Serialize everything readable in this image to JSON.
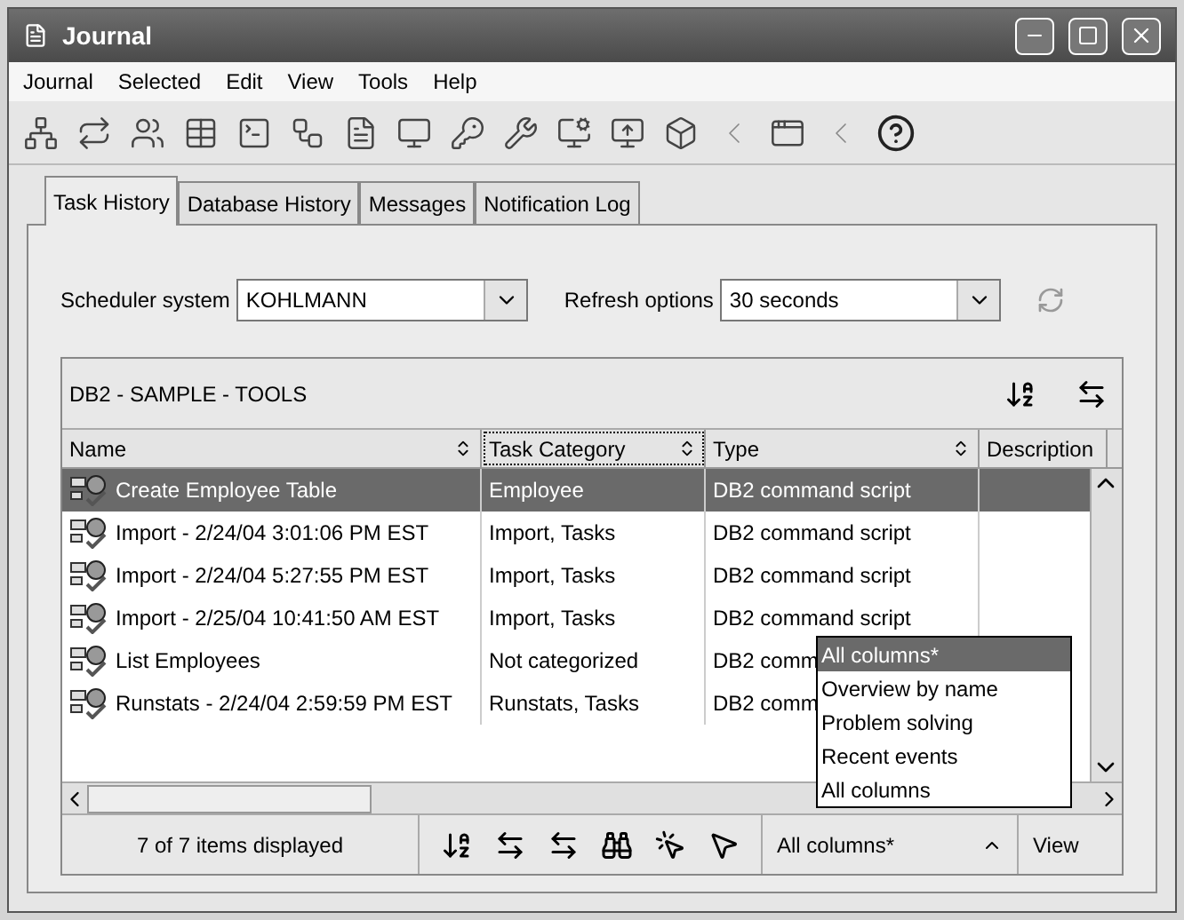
{
  "window": {
    "title": "Journal"
  },
  "menu": [
    "Journal",
    "Selected",
    "Edit",
    "View",
    "Tools",
    "Help"
  ],
  "tabs": [
    {
      "label": "Task History",
      "selected": true
    },
    {
      "label": "Database History",
      "selected": false
    },
    {
      "label": "Messages",
      "selected": false
    },
    {
      "label": "Notification Log",
      "selected": false
    }
  ],
  "scheduler": {
    "label": "Scheduler system",
    "value": "KOHLMANN"
  },
  "refresh": {
    "label": "Refresh options",
    "value": "30 seconds"
  },
  "table": {
    "title": "DB2 - SAMPLE - TOOLS",
    "columns": [
      {
        "label": "Name",
        "focused": false
      },
      {
        "label": "Task Category",
        "focused": true
      },
      {
        "label": "Type",
        "focused": false
      },
      {
        "label": "Description",
        "focused": false
      }
    ],
    "rows": [
      {
        "name": "Create Employee Table",
        "category": "Employee",
        "type": "DB2 command script",
        "selected": true
      },
      {
        "name": "Import - 2/24/04 3:01:06 PM EST",
        "category": "Import, Tasks",
        "type": "DB2 command script",
        "selected": false
      },
      {
        "name": "Import - 2/24/04 5:27:55 PM EST",
        "category": "Import, Tasks",
        "type": "DB2 command script",
        "selected": false
      },
      {
        "name": "Import - 2/25/04 10:41:50 AM EST",
        "category": "Import, Tasks",
        "type": "DB2 command script",
        "selected": false
      },
      {
        "name": "List Employees",
        "category": "Not categorized",
        "type": "DB2 comm",
        "selected": false
      },
      {
        "name": "Runstats - 2/24/04 2:59:59 PM EST",
        "category": "Runstats, Tasks",
        "type": "DB2 comm",
        "selected": false
      }
    ]
  },
  "status": "7 of 7 items displayed",
  "view_select": {
    "value": "All columns*",
    "options": [
      {
        "label": "All columns*",
        "selected": true
      },
      {
        "label": "Overview by name",
        "selected": false
      },
      {
        "label": "Problem solving",
        "selected": false
      },
      {
        "label": "Recent events",
        "selected": false
      },
      {
        "label": "All columns",
        "selected": false
      }
    ]
  },
  "view_button": "View"
}
